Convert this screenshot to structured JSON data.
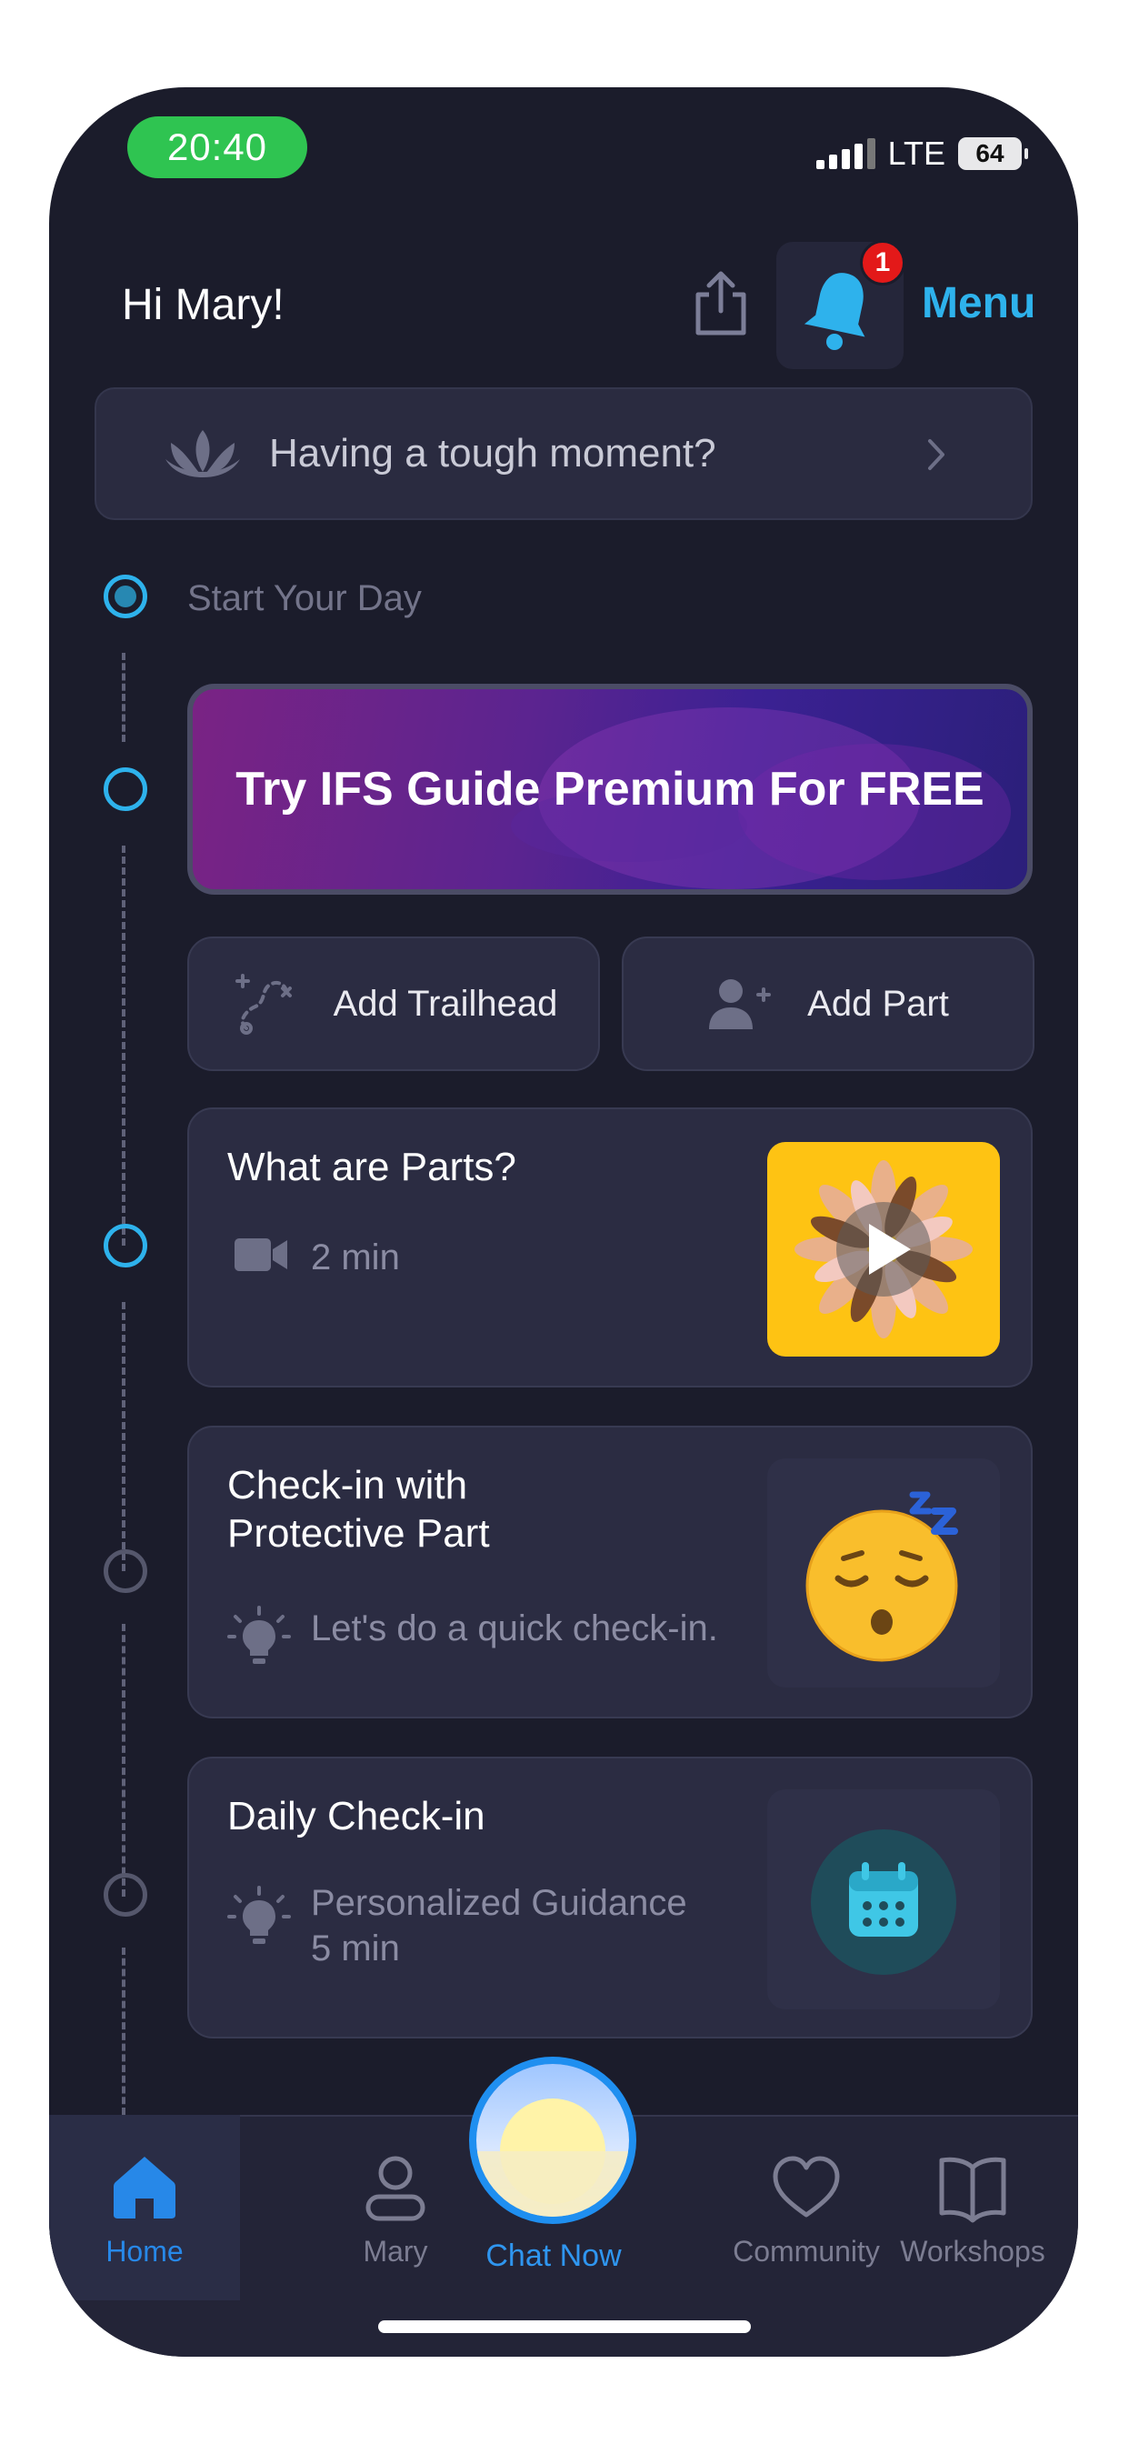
{
  "status_bar": {
    "time": "20:40",
    "network": "LTE",
    "battery": "64"
  },
  "header": {
    "greeting": "Hi Mary!",
    "notification_count": "1",
    "menu_label": "Menu"
  },
  "tough_moment": {
    "label": "Having a tough moment?"
  },
  "timeline": {
    "start_label": "Start Your Day",
    "premium_banner": "Try IFS Guide Premium For FREE",
    "add_trailhead": "Add Trailhead",
    "add_part": "Add Part",
    "cards": [
      {
        "title": "What are Parts?",
        "meta": "2 min",
        "icon": "video-camera-icon"
      },
      {
        "title": "Check-in with Protective Part",
        "meta": "Let's do a quick check-in.",
        "icon": "lightbulb-icon"
      },
      {
        "title": "Daily Check-in",
        "meta": "Personalized Guidance",
        "meta2": "5 min",
        "icon": "lightbulb-icon"
      }
    ]
  },
  "tabs": [
    {
      "label": "Home",
      "icon": "home-icon",
      "active": true
    },
    {
      "label": "Mary",
      "icon": "person-icon"
    },
    {
      "label": "Chat Now",
      "icon": "sunrise-icon"
    },
    {
      "label": "Community",
      "icon": "heart-icon"
    },
    {
      "label": "Workshops",
      "icon": "book-icon"
    }
  ],
  "colors": {
    "accent": "#2eb2ec",
    "background": "#1b1c2b",
    "card": "#2b2c42",
    "badge": "#e31919",
    "thumb_yellow": "#fec313"
  }
}
